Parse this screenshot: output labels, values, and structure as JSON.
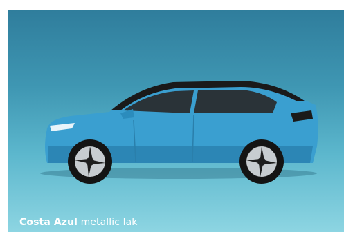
{
  "caption": {
    "color_name": "Costa Azul",
    "finish": "metallic lak"
  },
  "colors": {
    "panel_top": "#2f7d9c",
    "panel_bottom": "#8dd5e2",
    "car_body": "#3a9fd0",
    "roof": "#1a1a1a",
    "caption_text": "#ffffff"
  },
  "icons": [
    "car-image"
  ]
}
